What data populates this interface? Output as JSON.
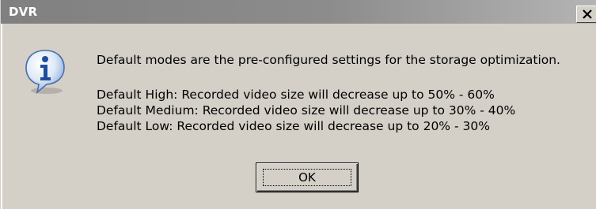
{
  "window": {
    "title": "DVR",
    "colors": {
      "titlebar": "#808080",
      "face": "#d4d0c8",
      "text": "#000000",
      "title_text": "#ffffff"
    }
  },
  "titlebar": {
    "close_icon": "close-icon"
  },
  "dialog": {
    "icon": "info-icon",
    "intro": "Default modes are the pre-configured settings for the storage optimization.",
    "lines": [
      "Default High: Recorded video size will decrease up to 50% - 60%",
      "Default Medium: Recorded video size will decrease up to 30% - 40%",
      "Default Low: Recorded video size will decrease up to 20% - 30%"
    ]
  },
  "buttons": {
    "ok_label": "OK"
  }
}
